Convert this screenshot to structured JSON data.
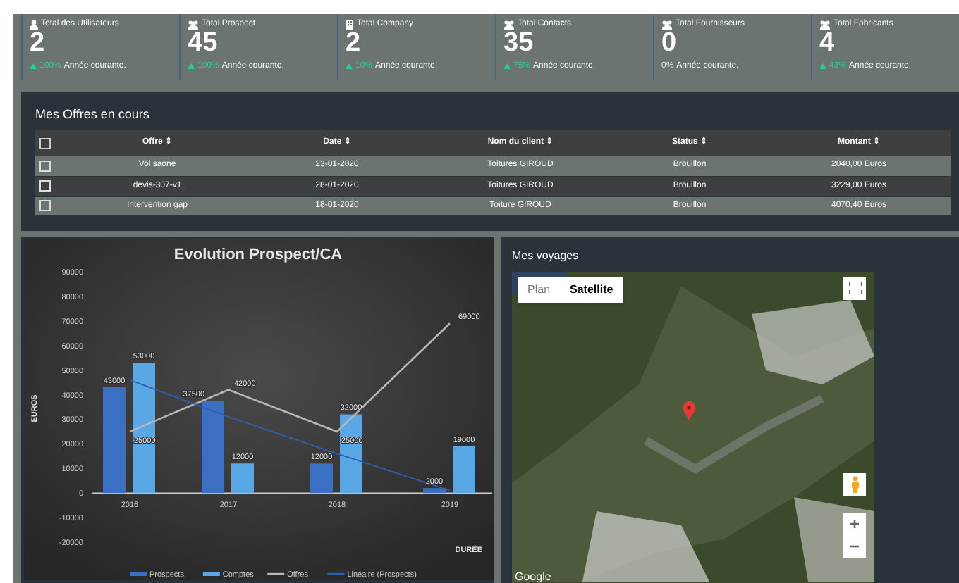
{
  "stats": [
    {
      "label": "Total des Utilisateurs",
      "value": "2",
      "rising": true,
      "percent": "100%",
      "period": "Année courante."
    },
    {
      "label": "Total Prospect",
      "value": "45",
      "rising": true,
      "percent": "100%",
      "period": "Année courante."
    },
    {
      "label": "Total Company",
      "value": "2",
      "rising": true,
      "percent": "10%",
      "period": "Année courante."
    },
    {
      "label": "Total Contacts",
      "value": "35",
      "rising": true,
      "percent": "75%",
      "period": "Année courante."
    },
    {
      "label": "Total Fournisseurs",
      "value": "0",
      "rising": false,
      "percent": "0%",
      "period": "Année courante."
    },
    {
      "label": "Total Fabricants",
      "value": "4",
      "rising": true,
      "percent": "43%",
      "period": "Année courante."
    }
  ],
  "offers": {
    "title": "Mes Offres en cours",
    "columns": [
      "Offre",
      "Date",
      "Nom du client",
      "Status",
      "Montant"
    ],
    "sort_glyph": "⇕",
    "header_checked": false,
    "rows": [
      {
        "checked": false,
        "cells": [
          "Vol saone",
          "23-01-2020",
          "Toitures GIROUD",
          "Brouillon",
          "2040,00 Euros"
        ]
      },
      {
        "checked": false,
        "cells": [
          "devis-307-v1",
          "28-01-2020",
          "Toitures GIROUD",
          "Brouillon",
          "3229,00 Euros"
        ]
      },
      {
        "checked": false,
        "cells": [
          "Intervention gap",
          "18-01-2020",
          "Toiture GIROUD",
          "Brouillon",
          "4070,40 Euros"
        ]
      }
    ]
  },
  "chart": {
    "chart_data": {
      "type": "bar",
      "title": "Evolution Prospect/CA",
      "xlabel": "DURÉE",
      "ylabel": "EUROS",
      "categories": [
        "2016",
        "2017",
        "2018",
        "2019"
      ],
      "series": [
        {
          "name": "Prospects",
          "color": "#3a6fc4",
          "type": "bar",
          "values": [
            43000,
            37500,
            12000,
            2000
          ]
        },
        {
          "name": "Comptes",
          "color": "#5aa7e6",
          "type": "bar",
          "values": [
            53000,
            12000,
            32000,
            19000
          ]
        },
        {
          "name": "Offres",
          "color": "#b8b8b8",
          "type": "line",
          "values": [
            25000,
            42000,
            25000,
            69000
          ]
        },
        {
          "name": "Linéaire (Prospects)",
          "color": "#2f5fb0",
          "type": "line",
          "values": [
            46000,
            31000,
            16000,
            1000
          ]
        }
      ],
      "stacked": false,
      "legend": "bottom",
      "ylim": [
        -20000,
        90000
      ],
      "yticks": [
        -20000,
        -10000,
        0,
        10000,
        20000,
        30000,
        40000,
        50000,
        60000,
        70000,
        80000,
        90000
      ],
      "value_labels": [
        [
          "43000",
          "37500",
          "12000",
          "2000"
        ],
        [
          "53000",
          "12000",
          "32000",
          "19000"
        ],
        [
          "25000",
          "42000",
          "25000",
          "69000"
        ],
        [
          null,
          null,
          null,
          null
        ]
      ]
    }
  },
  "map": {
    "title": "Mes voyages",
    "map_types": [
      {
        "label": "Plan",
        "selected": false
      },
      {
        "label": "Satellite",
        "selected": true
      }
    ],
    "attribution": "Google",
    "zoom_in": "+",
    "zoom_out": "−"
  }
}
